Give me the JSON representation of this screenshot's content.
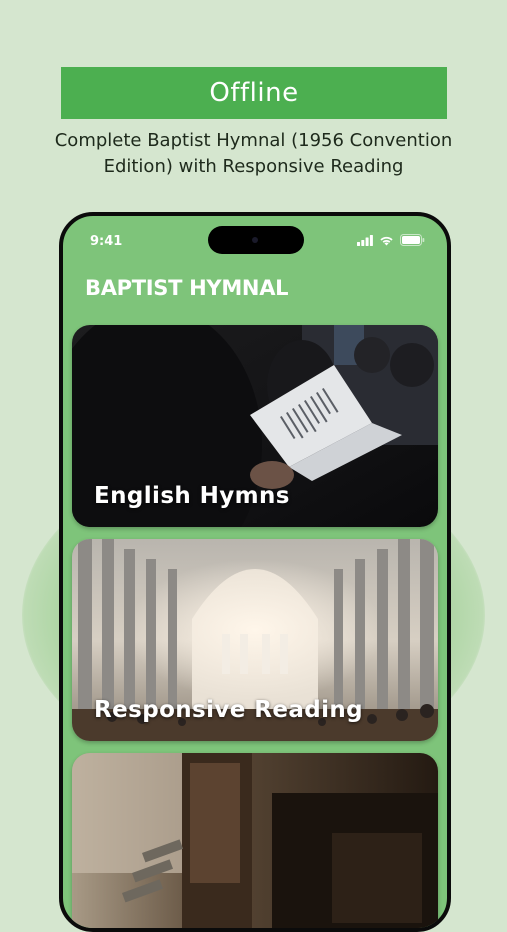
{
  "banner": {
    "label": "Offline"
  },
  "subtitle": {
    "line1": "Complete Baptist Hymnal (1956 Convention",
    "line2": "Edition) with Responsive Reading"
  },
  "phone": {
    "status_time": "9:41",
    "app_title": "BAPTIST HYMNAL",
    "cards": [
      {
        "label": "English Hymns"
      },
      {
        "label": "Responsive Reading"
      },
      {
        "label": ""
      }
    ]
  },
  "colors": {
    "background": "#d5e6cf",
    "banner": "#4caf50",
    "phone_bg": "#7ec47a"
  }
}
